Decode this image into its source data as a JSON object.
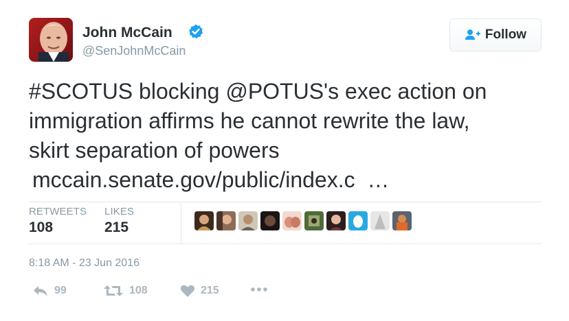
{
  "author": {
    "name": "John McCain",
    "handle": "@SenJohnMcCain",
    "verified": true
  },
  "follow_button": {
    "label": "Follow",
    "icon": "add-user-icon"
  },
  "tweet": {
    "lines": [
      "#SCOTUS blocking @POTUS's exec action on",
      "immigration affirms he cannot rewrite the law,",
      "skirt separation of powers"
    ],
    "link": "mccain.senate.gov/public/index.c  …"
  },
  "stats": {
    "retweets_label": "RETWEETS",
    "retweets": "108",
    "likes_label": "LIKES",
    "likes": "215"
  },
  "likers_count_shown": 9,
  "timestamp": "8:18 AM - 23 Jun 2016",
  "actions": {
    "reply_count": "99",
    "retweet_count": "108",
    "like_count": "215"
  },
  "colors": {
    "text": "#292f33",
    "muted": "#8899a6",
    "action": "#aab8c2",
    "verified": "#1da1f2",
    "divider": "#e1e8ed"
  }
}
